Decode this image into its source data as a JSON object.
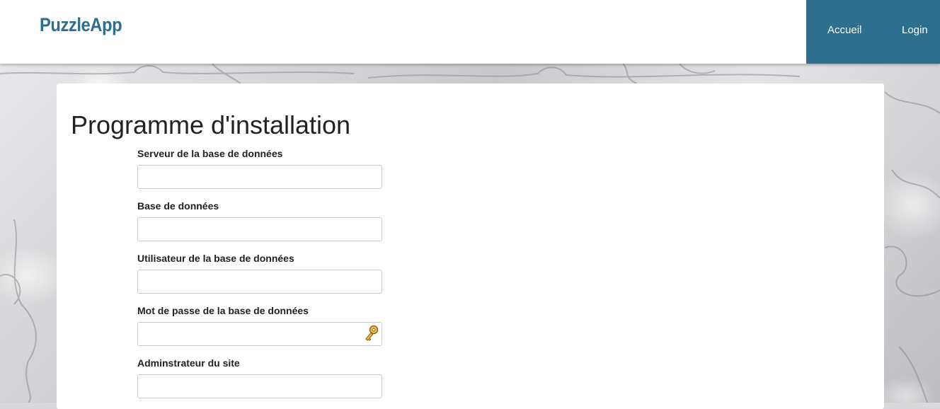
{
  "header": {
    "brand": "PuzzleApp",
    "nav": {
      "home": "Accueil",
      "login": "Login"
    }
  },
  "main": {
    "title": "Programme d'installation",
    "fields": [
      {
        "label": "Serveur de la base de données",
        "value": "",
        "type": "text"
      },
      {
        "label": "Base de données",
        "value": "",
        "type": "text"
      },
      {
        "label": "Utilisateur de la base de données",
        "value": "",
        "type": "text"
      },
      {
        "label": "Mot de passe de la base de données",
        "value": "",
        "type": "password",
        "icon": "key-icon"
      },
      {
        "label": "Adminstrateur du site",
        "value": "",
        "type": "text"
      }
    ]
  },
  "colors": {
    "brand": "#2e6e8e",
    "nav_bg": "#2e6e8e",
    "nav_text": "#ffffff",
    "input_border": "#cccccc"
  }
}
